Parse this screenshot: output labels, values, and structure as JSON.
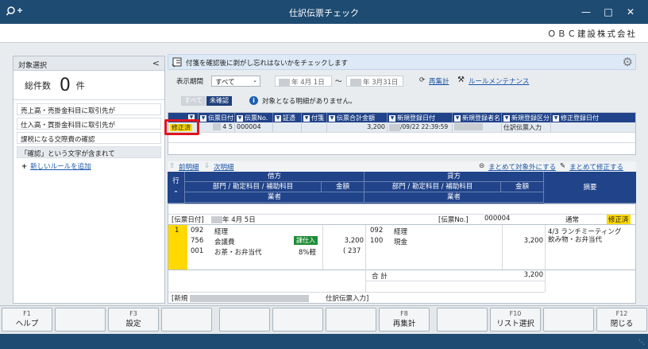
{
  "window": {
    "title": "仕訳伝票チェック",
    "company": "ＯＢＣ建設株式会社",
    "controls": [
      "minimize-icon",
      "maximize-icon",
      "close-icon"
    ]
  },
  "left_panel": {
    "header": "対象選択",
    "collapse": "<",
    "total_label": "総件数",
    "total_value": "0",
    "total_unit": "件",
    "rules": [
      "売上高・売掛金科目に取引先が",
      "仕入高・買掛金科目に取引先が",
      "課税になる交際費の確認",
      "「確認」という文字が含まれて"
    ],
    "add_rule": "新しいルールを追加"
  },
  "info_bar": {
    "text": "付箋を確認後に剥がし忘れはないかをチェックします"
  },
  "period": {
    "label": "表示期間",
    "select": "すべて",
    "from": "年  4月  1日",
    "tilde": "〜",
    "to": "年  3月31日",
    "recalc": "再集計",
    "rule_maint": "ルールメンテナンス"
  },
  "filter": {
    "all": "すべて",
    "unconfirmed": "未確認",
    "message": "対象となる明細がありません。"
  },
  "slip_list": {
    "columns": [
      "伝票日付",
      "伝票No.",
      "証憑",
      "付箋",
      "伝票合計金額",
      "新規登録日付",
      "新規登録者名",
      "新規登録区分",
      "修正登録日付"
    ],
    "row": {
      "status": "修正済",
      "date": "4  5",
      "no": "000004",
      "total": "3,200",
      "reg_date": "/09/22 22:39:59",
      "reg_type": "仕訳伝票入力"
    }
  },
  "detail_nav": {
    "prev": "前明細",
    "next": "次明細",
    "exclude_all": "まとめて対象外にする",
    "fix_all": "まとめて修正する"
  },
  "detail_header": {
    "row_label": "行",
    "debit": "借方",
    "credit": "貸方",
    "account_cols": "部門 / 勘定科目 / 補助科目",
    "amount": "金額",
    "vendor": "業者",
    "summary": "摘要"
  },
  "detail": {
    "date_label": "[伝票日付]",
    "date": "年  4月  5日",
    "no_label": "[伝票No.]",
    "no": "000004",
    "type": "通常",
    "status": "修正済",
    "line_no": "1",
    "debit": {
      "dept": "092",
      "dept_name": "経理",
      "acct": "756",
      "acct_name": "会議費",
      "tax": "課仕入",
      "sub": "001",
      "sub_name": "お茶・お弁当代",
      "tax_rate": "8%軽",
      "amount": "3,200",
      "tax_amount": "( 237"
    },
    "credit": {
      "dept": "092",
      "dept_name": "経理",
      "acct": "100",
      "acct_name": "現金",
      "amount": "3,200"
    },
    "summary_1": "4/3 ランチミーティング",
    "summary_2": "飲み物・お弁当代",
    "total_label": "合 計",
    "total": "3,200",
    "new_label": "[新規",
    "new_type": "仕訳伝票入力]"
  },
  "fkeys": [
    {
      "key": "F1",
      "label": "ヘルプ"
    },
    {
      "key": "",
      "label": ""
    },
    {
      "key": "F3",
      "label": "設定"
    },
    {
      "key": "",
      "label": ""
    },
    {
      "key": "",
      "label": ""
    },
    {
      "key": "",
      "label": ""
    },
    {
      "key": "",
      "label": ""
    },
    {
      "key": "F8",
      "label": "再集計"
    },
    {
      "key": "",
      "label": ""
    },
    {
      "key": "F10",
      "label": "リスト選択"
    },
    {
      "key": "",
      "label": ""
    },
    {
      "key": "F12",
      "label": "閉じる"
    }
  ]
}
